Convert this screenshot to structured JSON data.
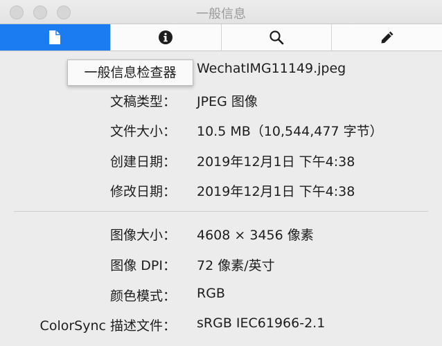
{
  "window": {
    "title": "一般信息"
  },
  "tabs": [
    {
      "name": "general",
      "icon": "document-icon"
    },
    {
      "name": "info",
      "icon": "info-icon"
    },
    {
      "name": "search",
      "icon": "search-icon"
    },
    {
      "name": "edit",
      "icon": "pencil-icon"
    }
  ],
  "tooltip": "一般信息检查器",
  "file_info": {
    "filename": "WechatIMG11149.jpeg",
    "kind_label": "文稿类型：",
    "kind_value": "JPEG 图像",
    "size_label": "文件大小：",
    "size_value": "10.5 MB（10,544,477 字节）",
    "created_label": "创建日期：",
    "created_value": "2019年12月1日 下午4:38",
    "modified_label": "修改日期：",
    "modified_value": "2019年12月1日 下午4:38"
  },
  "image_info": {
    "dimensions_label": "图像大小：",
    "dimensions_value": "4608 × 3456 像素",
    "dpi_label": "图像 DPI：",
    "dpi_value": "72 像素/英寸",
    "color_model_label": "颜色模式：",
    "color_model_value": "RGB",
    "profile_label": "ColorSync 描述文件：",
    "profile_value": "sRGB IEC61966-2.1"
  },
  "colors": {
    "active_tab": "#1b7cf2",
    "window_bg": "#ececec"
  }
}
